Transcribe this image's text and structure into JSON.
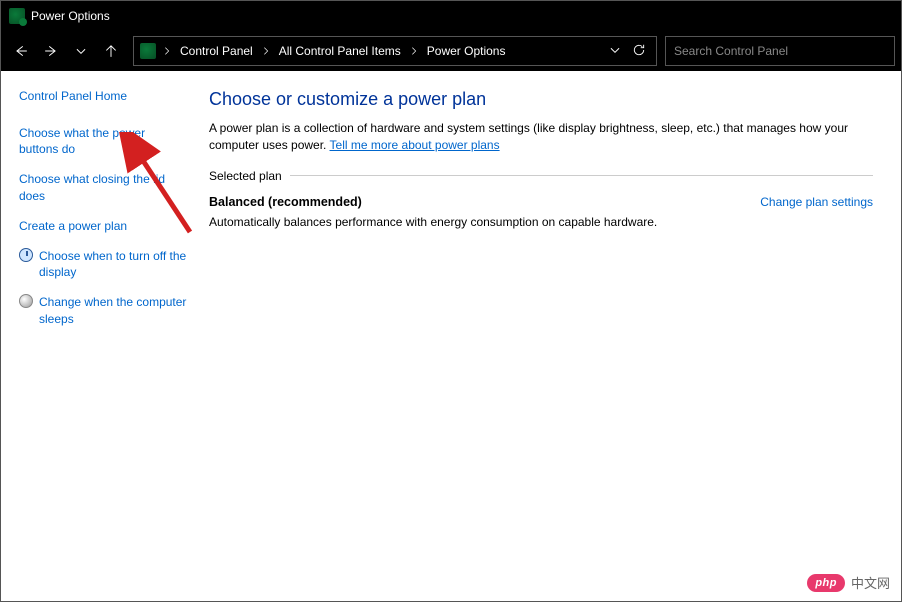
{
  "window": {
    "title": "Power Options"
  },
  "breadcrumbs": {
    "b0": "Control Panel",
    "b1": "All Control Panel Items",
    "b2": "Power Options"
  },
  "search": {
    "placeholder": "Search Control Panel"
  },
  "sidebar": {
    "home": "Control Panel Home",
    "links": {
      "l0": "Choose what the power buttons do",
      "l1": "Choose what closing the lid does",
      "l2": "Create a power plan",
      "l3": "Choose when to turn off the display",
      "l4": "Change when the computer sleeps"
    }
  },
  "main": {
    "title": "Choose or customize a power plan",
    "desc1": "A power plan is a collection of hardware and system settings (like display brightness, sleep, etc.) that manages how your computer uses power. ",
    "desc_link": "Tell me more about power plans",
    "section_label": "Selected plan",
    "plan_name": "Balanced (recommended)",
    "plan_desc": "Automatically balances performance with energy consumption on capable hardware.",
    "change_plan": "Change plan settings"
  },
  "watermark": {
    "badge": "php",
    "text": "中文网"
  },
  "colors": {
    "link": "#0066cc",
    "title": "#003399",
    "arrow": "#d32020"
  }
}
